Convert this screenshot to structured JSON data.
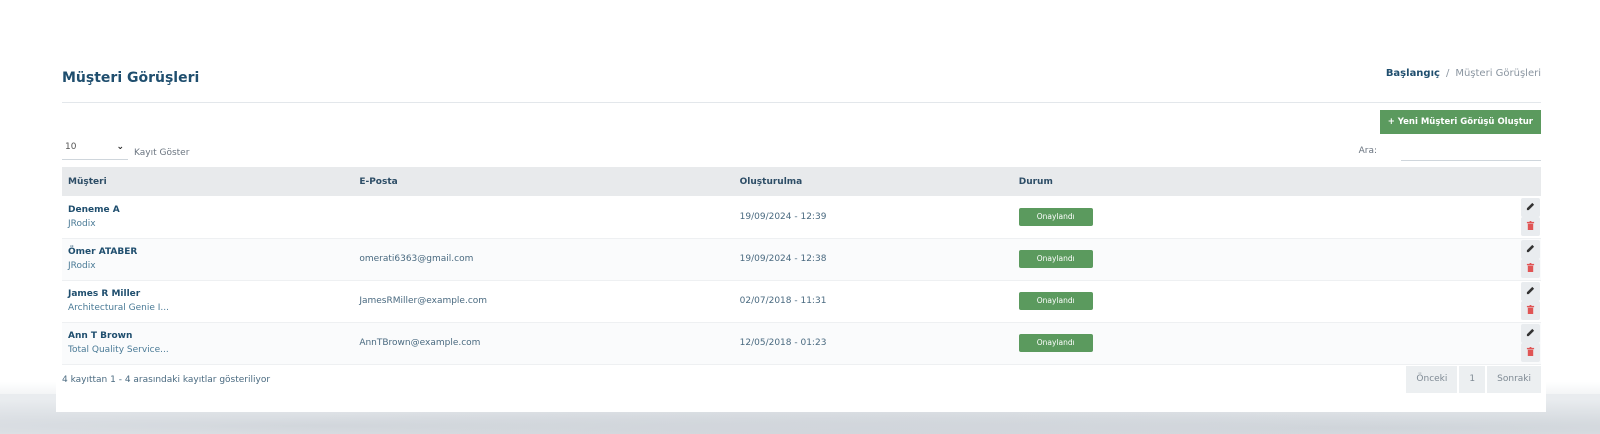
{
  "page": {
    "title": "Müşteri Görüşleri",
    "breadcrumb": {
      "home": "Başlangıç",
      "separator": "/",
      "current": "Müşteri Görüşleri"
    }
  },
  "toolbar": {
    "new_button_label": "+ Yeni Müşteri Görüşü Oluştur",
    "length_value": "10",
    "length_label": "Kayıt Göster",
    "search_label": "Ara:",
    "search_value": ""
  },
  "table": {
    "headers": [
      "Müşteri",
      "E-Posta",
      "Oluşturulma",
      "Durum",
      ""
    ],
    "rows": [
      {
        "name": "Deneme A",
        "company": "JRodix",
        "email": "",
        "created": "19/09/2024 - 12:39",
        "status": "Onaylandı"
      },
      {
        "name": "Ömer ATABER",
        "company": "JRodix",
        "email": "omerati6363@gmail.com",
        "created": "19/09/2024 - 12:38",
        "status": "Onaylandı"
      },
      {
        "name": "James R Miller",
        "company": "Architectural Genie I...",
        "email": "JamesRMiller@example.com",
        "created": "02/07/2018 - 11:31",
        "status": "Onaylandı"
      },
      {
        "name": "Ann T Brown",
        "company": "Total Quality Service...",
        "email": "AnnTBrown@example.com",
        "created": "12/05/2018 - 01:23",
        "status": "Onaylandı"
      }
    ]
  },
  "footer": {
    "info": "4 kayıttan 1 - 4 arasındaki kayıtlar gösteriliyor",
    "prev_label": "Önceki",
    "page_number": "1",
    "next_label": "Sonraki"
  },
  "colors": {
    "accent_green": "#5b9a5e",
    "title_blue": "#1f4e6e",
    "delete_red": "#e05555"
  },
  "icons": {
    "edit": "pencil-icon",
    "delete": "trash-icon",
    "dropdown": "chevron-down-icon"
  }
}
